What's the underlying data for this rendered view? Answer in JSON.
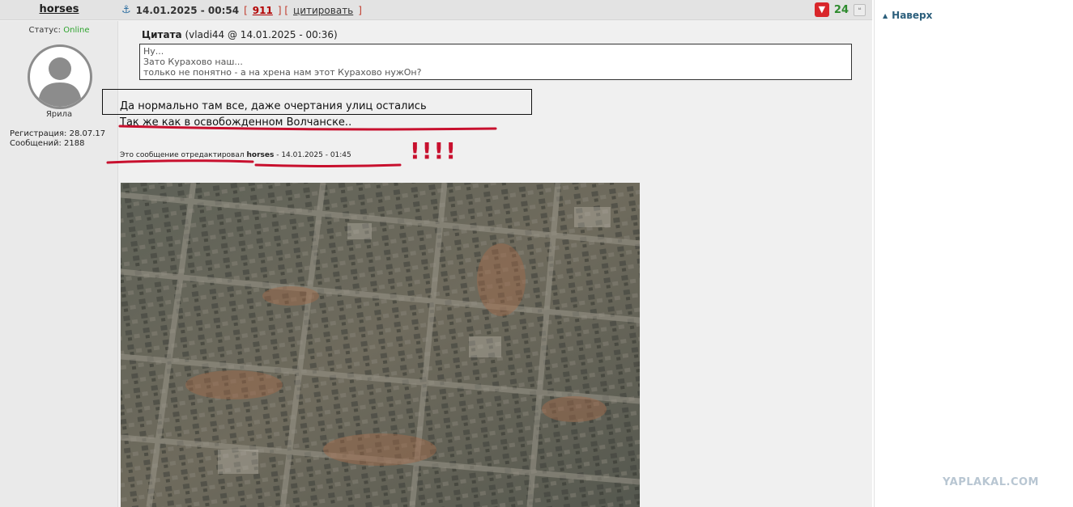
{
  "post": {
    "author": "horses",
    "date": "14.01.2025 - 00:54",
    "bracket_open": "[",
    "bracket_sep": "] [",
    "bracket_close": "]",
    "post_number": "911",
    "quote_label": "цитировать",
    "rating": "24"
  },
  "author_info": {
    "status_label": "Статус:",
    "status_value": "Online",
    "rank": "Ярила",
    "registration": "Регистрация: 28.07.17",
    "messages": "Сообщений: 2188"
  },
  "quote": {
    "title": "Цитата",
    "meta": "(vladi44 @ 14.01.2025 - 00:36)",
    "lines": [
      "Ну...",
      "Зато Курахово наш...",
      "только не понятно - а на хрена нам этот Курахово нужОн?"
    ]
  },
  "body": {
    "line1": "Да нормально там все, даже очертания улиц остались",
    "line2": "Так же как в освобожденном Волчанске..",
    "edit_prefix": "Это сообщение отредактировал",
    "edit_author": "horses",
    "edit_date": "- 14.01.2025 - 01:45",
    "annotation": "!!!!"
  },
  "sidebar": {
    "to_top": "Наверх",
    "watermark": "YAPLAKAL.COM"
  },
  "colors": {
    "accent_red": "#c8102e",
    "online_green": "#2fa42f",
    "link_blue": "#2c5f7c"
  }
}
